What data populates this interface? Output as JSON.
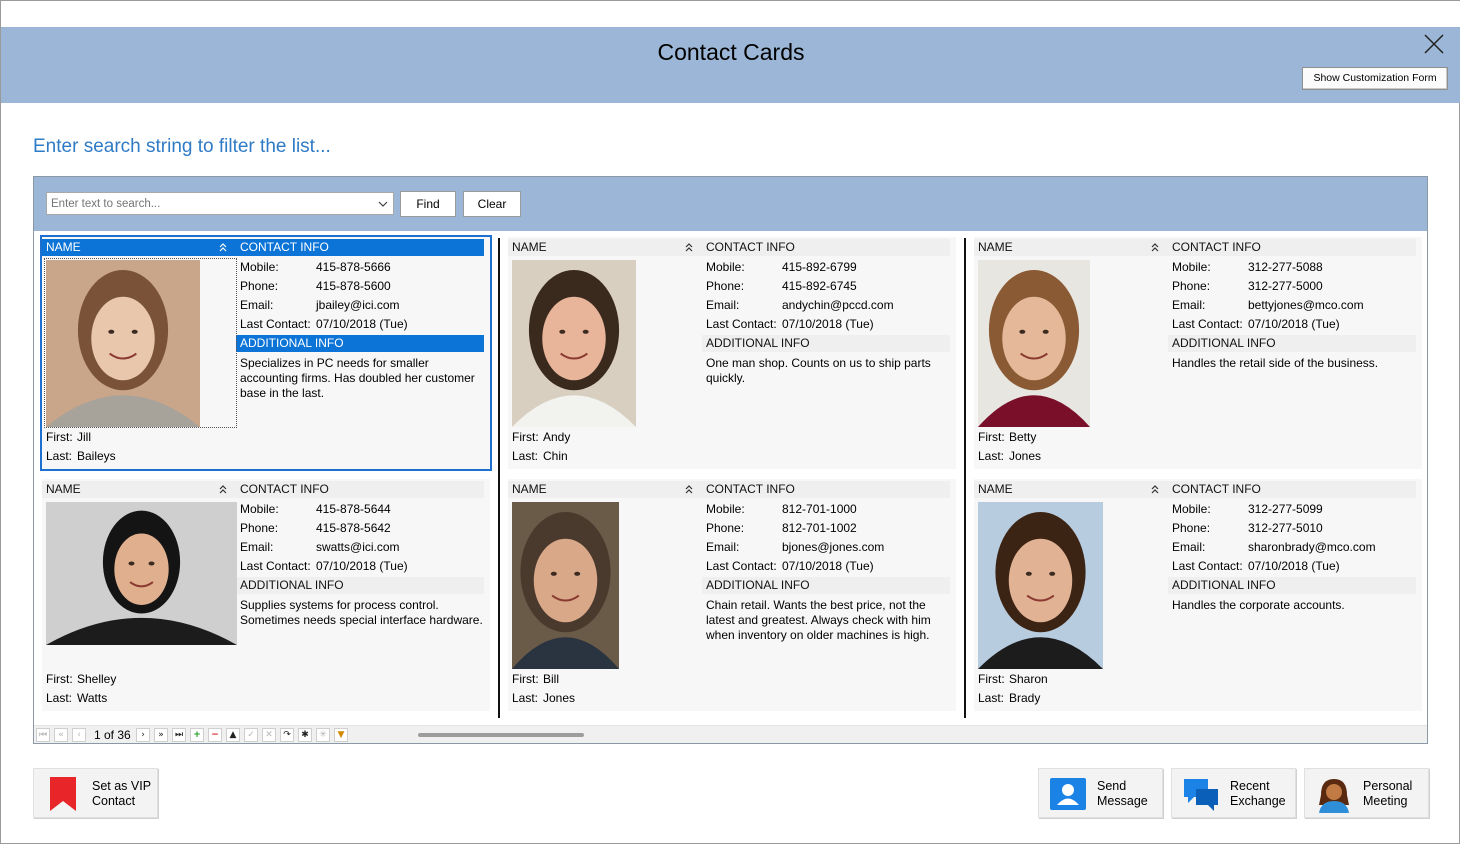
{
  "window": {
    "title": "Contact Cards",
    "customization_button": "Show Customization Form"
  },
  "filter": {
    "heading": "Enter search string to filter the list...",
    "search_placeholder": "Enter text to search...",
    "find_label": "Find",
    "clear_label": "Clear"
  },
  "card_labels": {
    "name_header": "NAME",
    "contact_header": "CONTACT INFO",
    "additional_header": "ADDITIONAL INFO",
    "mobile": "Mobile:",
    "phone": "Phone:",
    "email": "Email:",
    "last_contact": "Last Contact:",
    "first": "First:",
    "last": "Last:"
  },
  "contacts": [
    {
      "first": "Jill",
      "last": "Baileys",
      "mobile": "415-878-5666",
      "phone": "415-878-5600",
      "email": "jbailey@ici.com",
      "last_contact": "07/10/2018 (Tue)",
      "info": "Specializes in PC needs for smaller accounting firms. Has doubled her customer base in the last.",
      "selected": true
    },
    {
      "first": "Andy",
      "last": "Chin",
      "mobile": "415-892-6799",
      "phone": "415-892-6745",
      "email": "andychin@pccd.com",
      "last_contact": "07/10/2018 (Tue)",
      "info": "One man shop. Counts on us to ship parts quickly.",
      "selected": false
    },
    {
      "first": "Betty",
      "last": "Jones",
      "mobile": "312-277-5088",
      "phone": "312-277-5000",
      "email": "bettyjones@mco.com",
      "last_contact": "07/10/2018 (Tue)",
      "info": "Handles the retail side of the business.",
      "selected": false
    },
    {
      "first": "Shelley",
      "last": "Watts",
      "mobile": "415-878-5644",
      "phone": "415-878-5642",
      "email": "swatts@ici.com",
      "last_contact": "07/10/2018 (Tue)",
      "info": "Supplies systems for process control. Sometimes needs special interface hardware.",
      "selected": false
    },
    {
      "first": "Bill",
      "last": "Jones",
      "mobile": "812-701-1000",
      "phone": "812-701-1002",
      "email": "bjones@jones.com",
      "last_contact": "07/10/2018 (Tue)",
      "info": "Chain retail. Wants the best price, not the latest and greatest. Always check with him when inventory on older machines is high.",
      "selected": false
    },
    {
      "first": "Sharon",
      "last": "Brady",
      "mobile": "312-277-5099",
      "phone": "312-277-5010",
      "email": "sharonbrady@mco.com",
      "last_contact": "07/10/2018 (Tue)",
      "info": "Handles the corporate accounts.",
      "selected": false
    }
  ],
  "navigator": {
    "position": "1 of 36"
  },
  "actions": {
    "vip": "Set as VIP Contact",
    "send": "Send Message",
    "recent": "Recent Exchange",
    "meeting": "Personal Meeting"
  },
  "colors": {
    "header_bg": "#9bb6d6",
    "selection": "#0b74d6",
    "heading_text": "#2f7bc5"
  }
}
